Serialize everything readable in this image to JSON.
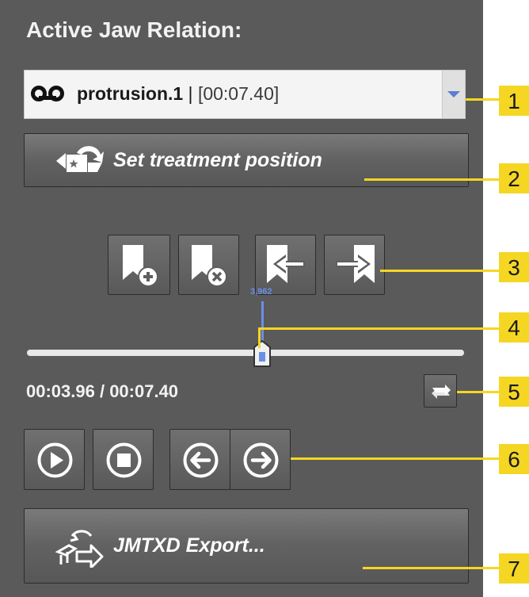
{
  "panel": {
    "title": "Active Jaw Relation:",
    "dropdown": {
      "icon": "tape-recording-icon",
      "recording_name": "protrusion.1",
      "separator": " | ",
      "duration": "[00:07.40]",
      "arrow_icon": "chevron-down-icon"
    },
    "set_treatment_button": {
      "label": "Set treatment position",
      "icon": "treatment-position-icon"
    },
    "bookmark_tools": [
      {
        "name": "add-bookmark",
        "icon": "bookmark-add-icon"
      },
      {
        "name": "remove-bookmark",
        "icon": "bookmark-remove-icon"
      },
      {
        "name": "previous-bookmark",
        "icon": "bookmark-previous-icon"
      },
      {
        "name": "next-bookmark",
        "icon": "bookmark-next-icon"
      }
    ],
    "slider": {
      "marker_value": "3,962",
      "position_fraction": 0.535
    },
    "time_display": "00:03.96 / 00:07.40",
    "loop_icon": "loop-icon",
    "playback": [
      {
        "name": "play",
        "icon": "play-icon"
      },
      {
        "name": "stop",
        "icon": "stop-icon"
      },
      {
        "name": "step-back",
        "icon": "arrow-left-icon"
      },
      {
        "name": "step-forward",
        "icon": "arrow-right-icon"
      }
    ],
    "export_button": {
      "label": "JMTXD Export...",
      "icon": "export-icon"
    }
  },
  "callouts": [
    "1",
    "2",
    "3",
    "4",
    "5",
    "6",
    "7"
  ],
  "colors": {
    "panel_bg": "#5a5a5a",
    "callout": "#f5d623",
    "slider_marker": "#6b8fe6"
  }
}
